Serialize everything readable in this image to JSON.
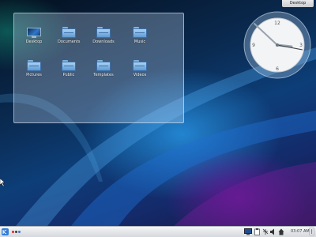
{
  "desktop": {
    "toolbox_label": "Desktop",
    "folder_view": {
      "items": [
        {
          "label": "Desktop",
          "icon": "desktop-icon"
        },
        {
          "label": "Documents",
          "icon": "folder-icon"
        },
        {
          "label": "Downloads",
          "icon": "folder-icon"
        },
        {
          "label": "Music",
          "icon": "folder-icon"
        },
        {
          "label": "Pictures",
          "icon": "folder-icon"
        },
        {
          "label": "Public",
          "icon": "folder-icon"
        },
        {
          "label": "Templates",
          "icon": "folder-icon"
        },
        {
          "label": "Videos",
          "icon": "folder-icon"
        }
      ]
    },
    "clock": {
      "numerals": [
        "12",
        "3",
        "6",
        "9"
      ],
      "time_shown": "approx. 03:02"
    }
  },
  "taskbar": {
    "launcher_icon": "kde-launcher-icon",
    "activity_dots": [
      {
        "color": "#e0242a"
      },
      {
        "color": "#3a3a3a"
      },
      {
        "color": "#3a78d8"
      }
    ],
    "tray_icons": [
      "display-icon",
      "clipboard-icon",
      "network-icon",
      "volume-icon",
      "notifications-icon"
    ],
    "clock_text": "03:07 AM",
    "corner_icon": "panel-toolbox-icon"
  },
  "colors": {
    "panel": "#e6e8ea",
    "folder_blue": "#7fb3e0",
    "accent": "#2f7ed8"
  }
}
